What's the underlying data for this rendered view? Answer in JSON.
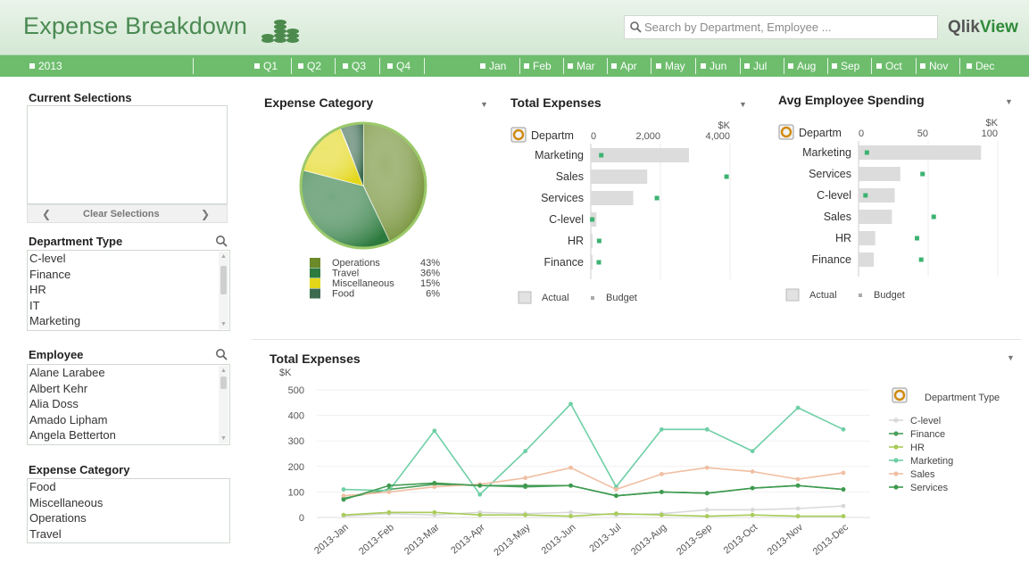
{
  "header": {
    "title": "Expense Breakdown",
    "search_placeholder": "Search by Department, Employee ...",
    "logo_prefix": "Qlik",
    "logo_suffix": "View"
  },
  "timebar": {
    "year": "2013",
    "quarters": [
      "Q1",
      "Q2",
      "Q3",
      "Q4"
    ],
    "months": [
      "Jan",
      "Feb",
      "Mar",
      "Apr",
      "May",
      "Jun",
      "Jul",
      "Aug",
      "Sep",
      "Oct",
      "Nov",
      "Dec"
    ]
  },
  "current_selections": {
    "title": "Current Selections",
    "clear_label": "Clear Selections"
  },
  "department_type": {
    "title": "Department Type",
    "items": [
      "C-level",
      "Finance",
      "HR",
      "IT",
      "Marketing"
    ]
  },
  "employee": {
    "title": "Employee",
    "items": [
      "Alane  Larabee",
      "Albert  Kehr",
      "Alia  Doss",
      "Amado  Lipham",
      "Angela  Betterton"
    ]
  },
  "expense_category_list": {
    "title": "Expense Category",
    "items": [
      "Food",
      "Miscellaneous",
      "Operations",
      "Travel"
    ]
  },
  "colors": {
    "accent": "#6dbd6d",
    "title_green": "#4a8a52",
    "budget": "#3cb371"
  },
  "chart_data": [
    {
      "type": "pie",
      "title": "Expense Category",
      "slices": [
        {
          "label": "Operations",
          "value": 43,
          "display": "43%",
          "color": "#6b8a2a"
        },
        {
          "label": "Travel",
          "value": 36,
          "display": "36%",
          "color": "#2c7a3e"
        },
        {
          "label": "Miscellaneous",
          "value": 15,
          "display": "15%",
          "color": "#e3d71a"
        },
        {
          "label": "Food",
          "value": 6,
          "display": "6%",
          "color": "#3c6b50"
        }
      ]
    },
    {
      "type": "bar",
      "title": "Total Expenses",
      "unit": "$K",
      "dim_label": "Departm",
      "xlim": [
        0,
        4000
      ],
      "ticks": [
        "0",
        "2,000",
        "4,000"
      ],
      "categories": [
        "Marketing",
        "Sales",
        "Services",
        "C-level",
        "HR",
        "Finance"
      ],
      "series": [
        {
          "name": "Actual",
          "values": [
            2820,
            1620,
            1220,
            160,
            40,
            30
          ]
        },
        {
          "name": "Budget",
          "values": [
            300,
            3900,
            1900,
            40,
            240,
            230
          ]
        }
      ]
    },
    {
      "type": "bar",
      "title": "Avg Employee Spending",
      "unit": "$K",
      "dim_label": "Departm",
      "xlim": [
        0,
        100
      ],
      "ticks": [
        "0",
        "50",
        "100"
      ],
      "categories": [
        "Marketing",
        "Services",
        "C-level",
        "Sales",
        "HR",
        "Finance"
      ],
      "series": [
        {
          "name": "Actual",
          "values": [
            88,
            30,
            26,
            24,
            12,
            11
          ]
        },
        {
          "name": "Budget",
          "values": [
            6,
            46,
            5,
            54,
            42,
            45
          ]
        }
      ]
    },
    {
      "type": "line",
      "title": "Total Expenses",
      "ylabel": "$K",
      "ylim": [
        0,
        500
      ],
      "yticks": [
        "0",
        "100",
        "200",
        "300",
        "400",
        "500"
      ],
      "legend_title": "Department Type",
      "categories": [
        "2013-Jan",
        "2013-Feb",
        "2013-Mar",
        "2013-Apr",
        "2013-May",
        "2013-Jun",
        "2013-Jul",
        "2013-Aug",
        "2013-Sep",
        "2013-Oct",
        "2013-Nov",
        "2013-Dec"
      ],
      "series": [
        {
          "name": "C-level",
          "color": "#d9d9d9",
          "values": [
            5,
            15,
            10,
            20,
            15,
            20,
            10,
            15,
            30,
            30,
            35,
            45
          ]
        },
        {
          "name": "Finance",
          "color": "#4aa05c",
          "values": [
            75,
            110,
            130,
            125,
            120,
            125,
            85,
            100,
            95,
            115,
            125,
            110
          ]
        },
        {
          "name": "HR",
          "color": "#a8cc5a",
          "values": [
            10,
            20,
            20,
            10,
            10,
            5,
            15,
            10,
            5,
            10,
            5,
            5
          ]
        },
        {
          "name": "Marketing",
          "color": "#6fcfa6",
          "values": [
            110,
            105,
            340,
            90,
            260,
            445,
            120,
            345,
            345,
            260,
            430,
            345
          ]
        },
        {
          "name": "Sales",
          "color": "#f0bfa3",
          "values": [
            85,
            100,
            120,
            130,
            155,
            195,
            110,
            170,
            195,
            180,
            150,
            175
          ]
        },
        {
          "name": "Services",
          "color": "#3d9a4e",
          "values": [
            70,
            125,
            135,
            125,
            125,
            125,
            85,
            100,
            95,
            115,
            125,
            110
          ]
        }
      ]
    }
  ],
  "panel_misc": {
    "legend_actual": "Actual",
    "legend_budget": "Budget"
  }
}
